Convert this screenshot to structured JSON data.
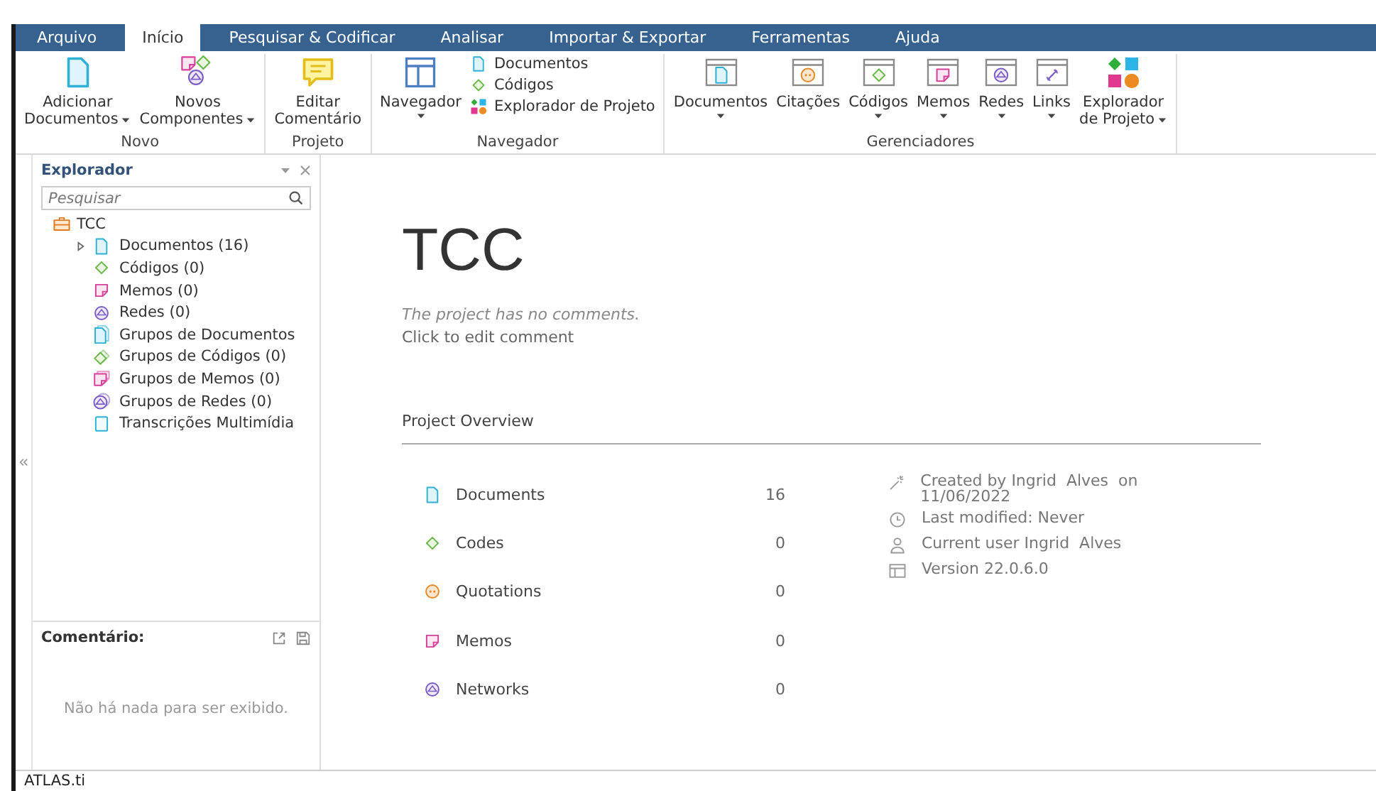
{
  "menu_tabs": [
    {
      "label": "Arquivo",
      "selected": false
    },
    {
      "label": "Início",
      "selected": true
    },
    {
      "label": "Pesquisar & Codificar",
      "selected": false
    },
    {
      "label": "Analisar",
      "selected": false
    },
    {
      "label": "Importar & Exportar",
      "selected": false
    },
    {
      "label": "Ferramentas",
      "selected": false
    },
    {
      "label": "Ajuda",
      "selected": false
    }
  ],
  "ribbon_groups": [
    {
      "label": "Novo",
      "buttons": [
        {
          "kind": "add-document",
          "lines": [
            "Adicionar",
            "Documentos"
          ],
          "dropdown": true
        },
        {
          "kind": "components",
          "lines": [
            "Novos",
            "Componentes"
          ],
          "dropdown": true
        }
      ]
    },
    {
      "label": "Projeto",
      "buttons": [
        {
          "kind": "comment",
          "lines": [
            "Editar",
            "Comentário"
          ],
          "dropdown": false
        }
      ]
    },
    {
      "label": "Navegador",
      "buttons": [
        {
          "kind": "navigator",
          "lines": [
            "Navegador"
          ],
          "dropdown": true
        }
      ],
      "links": [
        {
          "kind": "document",
          "label": "Documentos"
        },
        {
          "kind": "code",
          "label": "Códigos"
        },
        {
          "kind": "explorer",
          "label": "Explorador de Projeto"
        }
      ]
    },
    {
      "label": "Gerenciadores",
      "buttons": [
        {
          "kind": "doc-manager",
          "lines": [
            "Documentos"
          ],
          "dropdown": true
        },
        {
          "kind": "quote-manager",
          "lines": [
            "Citações"
          ],
          "dropdown": false
        },
        {
          "kind": "code-manager",
          "lines": [
            "Códigos"
          ],
          "dropdown": true
        },
        {
          "kind": "memo-manager",
          "lines": [
            "Memos"
          ],
          "dropdown": true
        },
        {
          "kind": "network-manager",
          "lines": [
            "Redes"
          ],
          "dropdown": true
        },
        {
          "kind": "link-manager",
          "lines": [
            "Links"
          ],
          "dropdown": true
        },
        {
          "kind": "explorer",
          "lines": [
            "Explorador",
            "de Projeto"
          ],
          "dropdown": true
        }
      ]
    }
  ],
  "explorer": {
    "title": "Explorador",
    "search": {
      "placeholder": "Pesquisar"
    },
    "tree": [
      {
        "kind": "project",
        "label": "TCC",
        "children": [
          {
            "kind": "document",
            "label": "Documentos (16)",
            "expanded": false
          },
          {
            "kind": "code",
            "label": "Códigos (0)"
          },
          {
            "kind": "memo",
            "label": "Memos (0)"
          },
          {
            "kind": "network",
            "label": "Redes (0)"
          },
          {
            "kind": "doc-group",
            "label": "Grupos de Documentos"
          },
          {
            "kind": "code-group",
            "label": "Grupos de Códigos (0)"
          },
          {
            "kind": "memo-group",
            "label": "Grupos de Memos (0)"
          },
          {
            "kind": "network-group",
            "label": "Grupos de Redes (0)"
          },
          {
            "kind": "transcription",
            "label": "Transcrições Multimídia"
          }
        ]
      }
    ]
  },
  "comment_panel": {
    "title": "Comentário:",
    "empty_text": "Não há nada para ser exibido."
  },
  "project": {
    "title": "TCC",
    "comment": "The project has no comments.",
    "edit_link": "Click to edit comment",
    "overview_title": "Project Overview",
    "counts": [
      {
        "kind": "document",
        "label": "Documents",
        "count": "16"
      },
      {
        "kind": "code",
        "label": "Codes",
        "count": "0"
      },
      {
        "kind": "quotation",
        "label": "Quotations",
        "count": "0"
      },
      {
        "kind": "memo",
        "label": "Memos",
        "count": "0"
      },
      {
        "kind": "network",
        "label": "Networks",
        "count": "0"
      }
    ],
    "info": [
      {
        "kind": "created",
        "text": "Created by Ingrid  Alves  on 11/06/2022"
      },
      {
        "kind": "modified",
        "text": "Last modified: Never"
      },
      {
        "kind": "user",
        "text": "Current user Ingrid  Alves"
      },
      {
        "kind": "version",
        "text": "Version 22.0.6.0"
      }
    ]
  },
  "status_bar": "ATLAS.ti"
}
